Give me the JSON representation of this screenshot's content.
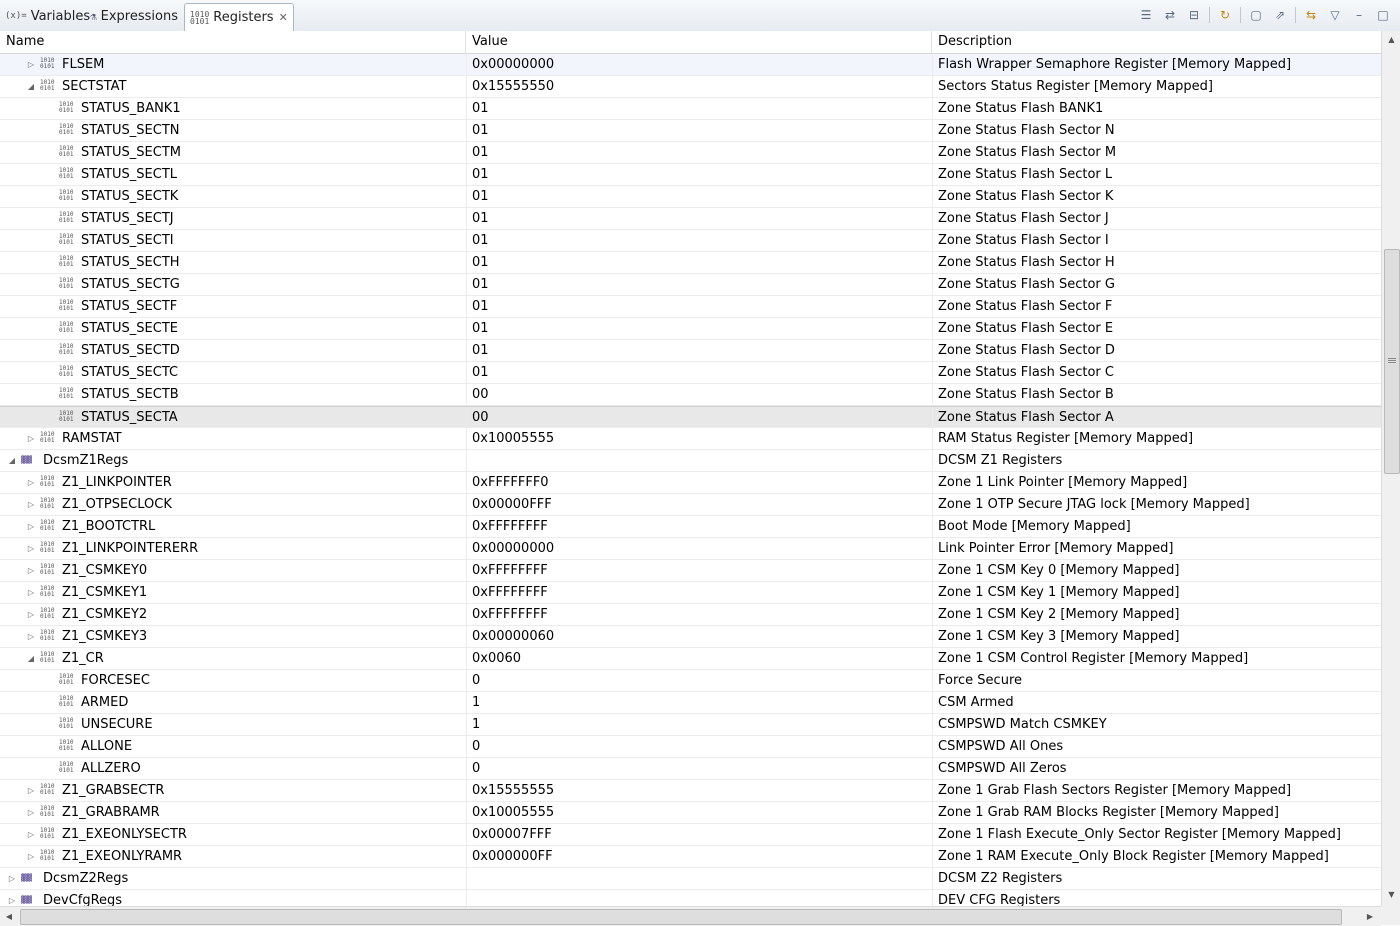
{
  "tabs": [
    {
      "label": "Variables",
      "icon": "(x)="
    },
    {
      "label": "Expressions",
      "icon": "expr"
    },
    {
      "label": "Registers",
      "icon": "1010\n0101",
      "active": true
    }
  ],
  "columns": {
    "name": "Name",
    "value": "Value",
    "description": "Description"
  },
  "rows": [
    {
      "name": "FLSEM",
      "value": "0x00000000",
      "desc": "Flash Wrapper Semaphore Register [Memory Mapped]",
      "level": 1,
      "expand": "collapsed",
      "kind": "register"
    },
    {
      "name": "SECTSTAT",
      "value": "0x15555550",
      "desc": "Sectors Status Register [Memory Mapped]",
      "level": 1,
      "expand": "expanded",
      "kind": "register"
    },
    {
      "name": "STATUS_BANK1",
      "value": "01",
      "desc": "Zone Status Flash BANK1",
      "level": 2,
      "expand": "none",
      "kind": "register"
    },
    {
      "name": "STATUS_SECTN",
      "value": "01",
      "desc": "Zone Status Flash Sector N",
      "level": 2,
      "expand": "none",
      "kind": "register"
    },
    {
      "name": "STATUS_SECTM",
      "value": "01",
      "desc": "Zone Status Flash Sector M",
      "level": 2,
      "expand": "none",
      "kind": "register"
    },
    {
      "name": "STATUS_SECTL",
      "value": "01",
      "desc": "Zone Status Flash Sector L",
      "level": 2,
      "expand": "none",
      "kind": "register"
    },
    {
      "name": "STATUS_SECTK",
      "value": "01",
      "desc": "Zone Status Flash Sector K",
      "level": 2,
      "expand": "none",
      "kind": "register"
    },
    {
      "name": "STATUS_SECTJ",
      "value": "01",
      "desc": "Zone Status Flash Sector J",
      "level": 2,
      "expand": "none",
      "kind": "register"
    },
    {
      "name": "STATUS_SECTI",
      "value": "01",
      "desc": "Zone Status Flash Sector I",
      "level": 2,
      "expand": "none",
      "kind": "register"
    },
    {
      "name": "STATUS_SECTH",
      "value": "01",
      "desc": "Zone Status Flash Sector H",
      "level": 2,
      "expand": "none",
      "kind": "register"
    },
    {
      "name": "STATUS_SECTG",
      "value": "01",
      "desc": "Zone Status Flash Sector G",
      "level": 2,
      "expand": "none",
      "kind": "register"
    },
    {
      "name": "STATUS_SECTF",
      "value": "01",
      "desc": "Zone Status Flash Sector F",
      "level": 2,
      "expand": "none",
      "kind": "register"
    },
    {
      "name": "STATUS_SECTE",
      "value": "01",
      "desc": "Zone Status Flash Sector E",
      "level": 2,
      "expand": "none",
      "kind": "register"
    },
    {
      "name": "STATUS_SECTD",
      "value": "01",
      "desc": "Zone Status Flash Sector D",
      "level": 2,
      "expand": "none",
      "kind": "register"
    },
    {
      "name": "STATUS_SECTC",
      "value": "01",
      "desc": "Zone Status Flash Sector C",
      "level": 2,
      "expand": "none",
      "kind": "register"
    },
    {
      "name": "STATUS_SECTB",
      "value": "00",
      "desc": "Zone Status Flash Sector B",
      "level": 2,
      "expand": "none",
      "kind": "register"
    },
    {
      "name": "STATUS_SECTA",
      "value": "00",
      "desc": "Zone Status Flash Sector A",
      "level": 2,
      "expand": "none",
      "kind": "register",
      "selected": true
    },
    {
      "name": "RAMSTAT",
      "value": "0x10005555",
      "desc": "RAM Status Register [Memory Mapped]",
      "level": 1,
      "expand": "collapsed",
      "kind": "register"
    },
    {
      "name": "DcsmZ1Regs",
      "value": "",
      "desc": "DCSM Z1 Registers",
      "level": 0,
      "expand": "expanded",
      "kind": "group"
    },
    {
      "name": "Z1_LINKPOINTER",
      "value": "0xFFFFFFF0",
      "desc": "Zone 1 Link Pointer [Memory Mapped]",
      "level": 1,
      "expand": "collapsed",
      "kind": "register"
    },
    {
      "name": "Z1_OTPSECLOCK",
      "value": "0x00000FFF",
      "desc": "Zone 1 OTP Secure JTAG lock [Memory Mapped]",
      "level": 1,
      "expand": "collapsed",
      "kind": "register"
    },
    {
      "name": "Z1_BOOTCTRL",
      "value": "0xFFFFFFFF",
      "desc": "Boot Mode [Memory Mapped]",
      "level": 1,
      "expand": "collapsed",
      "kind": "register"
    },
    {
      "name": "Z1_LINKPOINTERERR",
      "value": "0x00000000",
      "desc": "Link Pointer Error [Memory Mapped]",
      "level": 1,
      "expand": "collapsed",
      "kind": "register"
    },
    {
      "name": "Z1_CSMKEY0",
      "value": "0xFFFFFFFF",
      "desc": "Zone 1 CSM Key 0 [Memory Mapped]",
      "level": 1,
      "expand": "collapsed",
      "kind": "register"
    },
    {
      "name": "Z1_CSMKEY1",
      "value": "0xFFFFFFFF",
      "desc": "Zone 1 CSM Key 1 [Memory Mapped]",
      "level": 1,
      "expand": "collapsed",
      "kind": "register"
    },
    {
      "name": "Z1_CSMKEY2",
      "value": "0xFFFFFFFF",
      "desc": "Zone 1 CSM Key 2 [Memory Mapped]",
      "level": 1,
      "expand": "collapsed",
      "kind": "register"
    },
    {
      "name": "Z1_CSMKEY3",
      "value": "0x00000060",
      "desc": "Zone 1 CSM Key 3 [Memory Mapped]",
      "level": 1,
      "expand": "collapsed",
      "kind": "register"
    },
    {
      "name": "Z1_CR",
      "value": "0x0060",
      "desc": "Zone 1 CSM Control Register [Memory Mapped]",
      "level": 1,
      "expand": "expanded",
      "kind": "register"
    },
    {
      "name": "FORCESEC",
      "value": "0",
      "desc": "Force Secure",
      "level": 2,
      "expand": "none",
      "kind": "register"
    },
    {
      "name": "ARMED",
      "value": "1",
      "desc": "CSM Armed",
      "level": 2,
      "expand": "none",
      "kind": "register"
    },
    {
      "name": "UNSECURE",
      "value": "1",
      "desc": "CSMPSWD Match CSMKEY",
      "level": 2,
      "expand": "none",
      "kind": "register"
    },
    {
      "name": "ALLONE",
      "value": "0",
      "desc": "CSMPSWD All Ones",
      "level": 2,
      "expand": "none",
      "kind": "register"
    },
    {
      "name": "ALLZERO",
      "value": "0",
      "desc": "CSMPSWD All Zeros",
      "level": 2,
      "expand": "none",
      "kind": "register"
    },
    {
      "name": "Z1_GRABSECTR",
      "value": "0x15555555",
      "desc": "Zone 1 Grab Flash Sectors Register [Memory Mapped]",
      "level": 1,
      "expand": "collapsed",
      "kind": "register"
    },
    {
      "name": "Z1_GRABRAMR",
      "value": "0x10005555",
      "desc": "Zone 1 Grab RAM Blocks Register [Memory Mapped]",
      "level": 1,
      "expand": "collapsed",
      "kind": "register"
    },
    {
      "name": "Z1_EXEONLYSECTR",
      "value": "0x00007FFF",
      "desc": "Zone 1 Flash Execute_Only Sector Register [Memory Mapped]",
      "level": 1,
      "expand": "collapsed",
      "kind": "register"
    },
    {
      "name": "Z1_EXEONLYRAMR",
      "value": "0x000000FF",
      "desc": "Zone 1 RAM Execute_Only Block Register [Memory Mapped]",
      "level": 1,
      "expand": "collapsed",
      "kind": "register"
    },
    {
      "name": "DcsmZ2Regs",
      "value": "",
      "desc": "DCSM Z2 Registers",
      "level": 0,
      "expand": "collapsed",
      "kind": "group"
    },
    {
      "name": "DevCfgRegs",
      "value": "",
      "desc": "DEV CFG Registers",
      "level": 0,
      "expand": "collapsed",
      "kind": "group"
    }
  ]
}
